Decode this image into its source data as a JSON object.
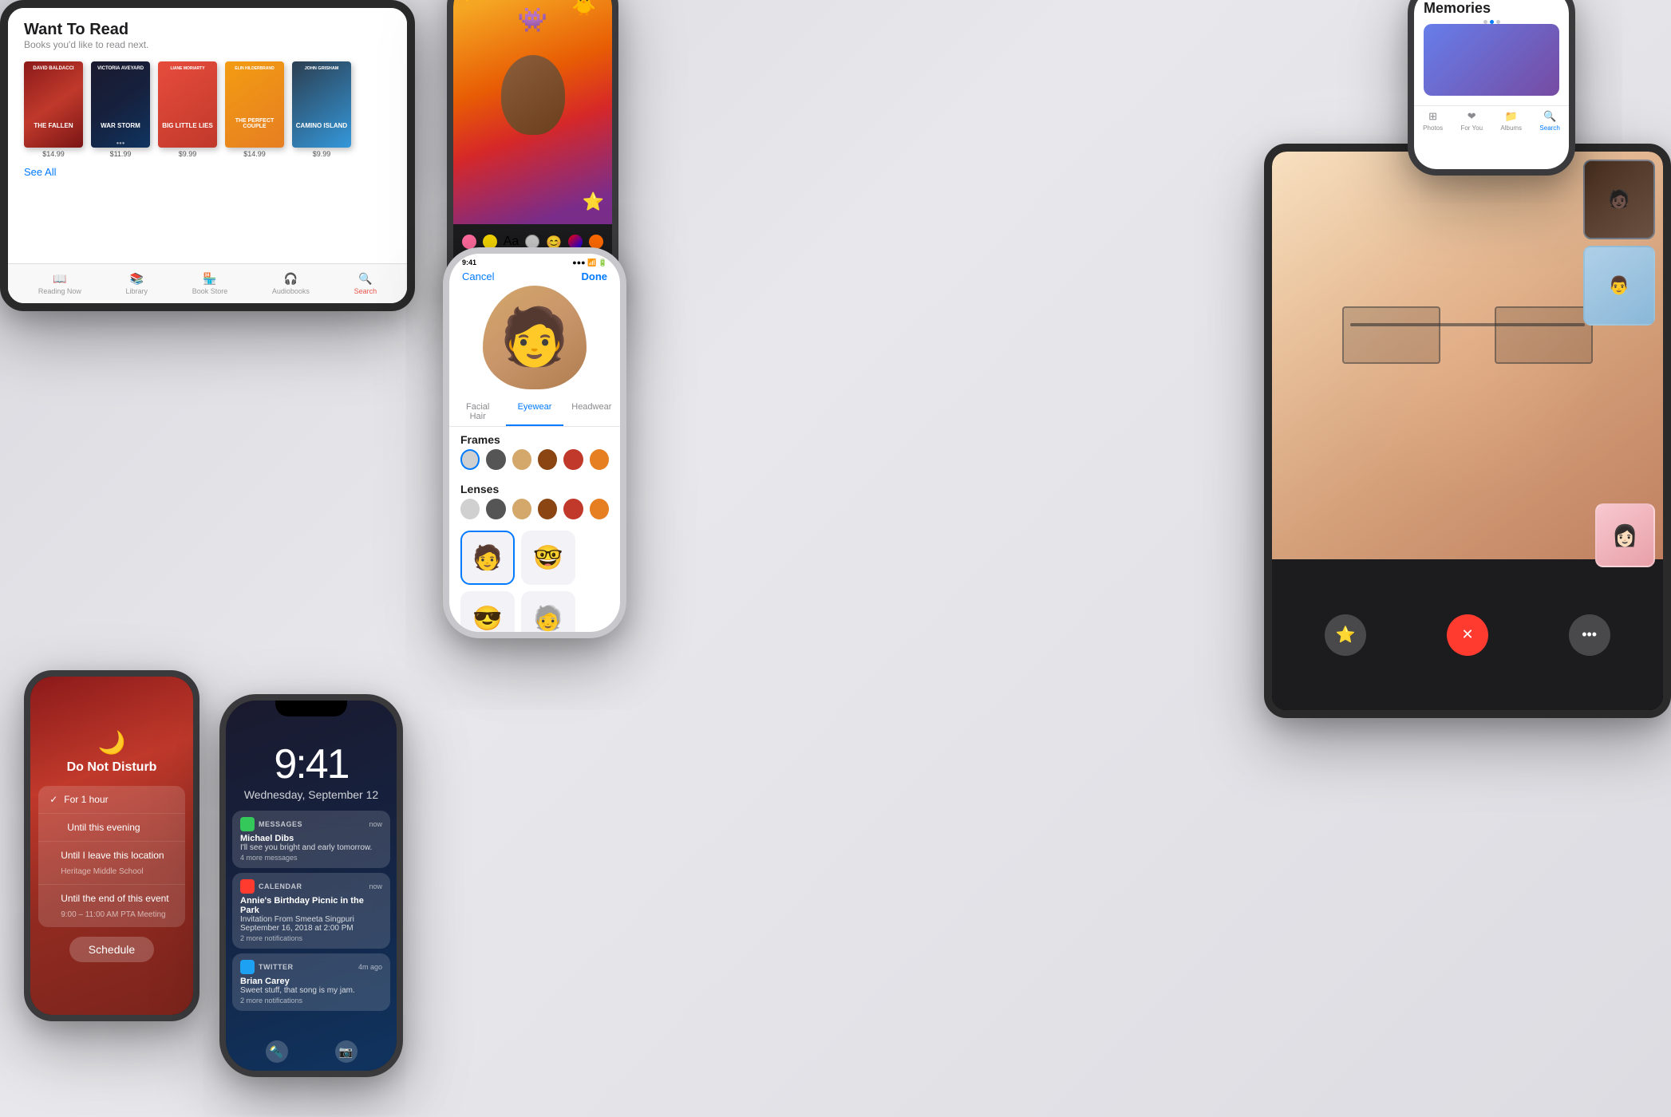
{
  "background": {
    "color": "#e0e0e6"
  },
  "tablet_books": {
    "title": "Want To Read",
    "subtitle": "Books you'd like to read next.",
    "see_all": "See All",
    "books": [
      {
        "author": "DAVID BALDACCI",
        "title": "THE FALLEN",
        "price": "$14.99",
        "color": "#8B1A1A"
      },
      {
        "author": "VICTORIA AVEYARD",
        "title": "WAR STORM",
        "price": "$11.99",
        "color": "#1a1a2e"
      },
      {
        "author": "LIANE MORIARTY",
        "title": "BIG LITTLE LIES",
        "price": "$9.99",
        "color": "#e74c3c"
      },
      {
        "author": "ELIN HILDERBRAND",
        "title": "THE PERFECT COUPLE",
        "price": "$14.99",
        "color": "#f39c12"
      },
      {
        "author": "JOHN GRISHAM",
        "title": "CAMINO ISLAND",
        "price": "$9.99",
        "color": "#2c3e50"
      }
    ],
    "tabs": [
      {
        "label": "Reading Now",
        "icon": "📖",
        "active": false
      },
      {
        "label": "Library",
        "icon": "📚",
        "active": false
      },
      {
        "label": "Book Store",
        "icon": "🏪",
        "active": false
      },
      {
        "label": "Audiobooks",
        "icon": "🎧",
        "active": false
      },
      {
        "label": "Search",
        "icon": "🔍",
        "active": false
      }
    ]
  },
  "iphone_dnd": {
    "icon": "🌙",
    "title": "Do Not Disturb",
    "options": [
      {
        "text": "For 1 hour",
        "checked": true,
        "sub": ""
      },
      {
        "text": "Until this evening",
        "checked": false,
        "sub": ""
      },
      {
        "text": "Until I leave this location",
        "checked": false,
        "sub": "Heritage Middle School"
      },
      {
        "text": "Until the end of this event",
        "checked": false,
        "sub": "9:00 – 11:00 AM PTA Meeting"
      }
    ],
    "schedule_label": "Schedule"
  },
  "iphone_x_lock": {
    "time": "9:41",
    "date": "Wednesday, September 12",
    "notifications": [
      {
        "app": "MESSAGES",
        "time": "now",
        "title": "Michael Dibs",
        "body": "I'll see you bright and early tomorrow.",
        "more": "4 more messages",
        "color": "#34c759"
      },
      {
        "app": "CALENDAR",
        "time": "now",
        "title": "Annie's Birthday Picnic in the Park",
        "body": "Invitation From Smeeta Singpuri\nSeptember 16, 2018 at 2:00 PM",
        "more": "2 more notifications",
        "color": "#ff3b30"
      },
      {
        "app": "TWITTER",
        "time": "4m ago",
        "title": "Brian Carey",
        "body": "Sweet stuff, that song is my jam.",
        "more": "2 more notifications",
        "color": "#1da1f2"
      }
    ]
  },
  "iphone_camera": {
    "has_photo": true
  },
  "iphone_memoji": {
    "status": {
      "time": "9:41",
      "signal": "●●●",
      "wifi": "wifi",
      "battery": "battery"
    },
    "cancel": "Cancel",
    "done": "Done",
    "tabs": [
      "Facial Hair",
      "Eyewear",
      "Headwear"
    ],
    "active_tab": "Eyewear",
    "frames_title": "Frames",
    "lenses_title": "Lenses",
    "frame_colors": [
      "#d0d0d0",
      "#555",
      "#d4a76a",
      "#8B4513",
      "#c0392b",
      "#e67e22"
    ],
    "lens_colors": [
      "#d0d0d0",
      "#555",
      "#d4a76a",
      "#8B4513",
      "#c0392b",
      "#e67e22"
    ]
  },
  "ipad_facetime": {
    "controls": {
      "star": "⭐",
      "end": "✕",
      "more": "•••"
    }
  },
  "iphone_photos": {
    "memories_title": "Memories",
    "tabs": [
      {
        "label": "Photos",
        "icon": "⊞",
        "active": false
      },
      {
        "label": "For You",
        "icon": "❤",
        "active": false
      },
      {
        "label": "Albums",
        "icon": "📁",
        "active": false
      },
      {
        "label": "Search",
        "icon": "🔍",
        "active": true
      }
    ]
  }
}
